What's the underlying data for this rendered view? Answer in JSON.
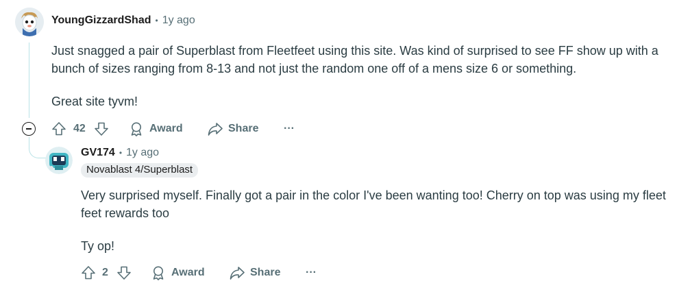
{
  "comments": [
    {
      "username": "YoungGizzardShad",
      "separator": "•",
      "time": "1y ago",
      "paragraphs": [
        "Just snagged a pair of Superblast from Fleetfeet using this site. Was kind of surprised to see FF show up with a bunch of sizes ranging from 8-13 and not just the random one off of a mens size 6 or something.",
        "Great site tyvm!"
      ],
      "votes": "42",
      "award_label": "Award",
      "share_label": "Share",
      "more_label": "···"
    },
    {
      "username": "GV174",
      "separator": "•",
      "time": "1y ago",
      "flair": "Novablast 4/Superblast",
      "paragraphs": [
        "Very surprised myself. Finally got a pair in the color I've been wanting too! Cherry on top was using my fleet feet rewards too",
        "Ty op!"
      ],
      "votes": "2",
      "award_label": "Award",
      "share_label": "Share",
      "more_label": "···"
    }
  ],
  "icons": {
    "upvote": "upvote-arrow-icon",
    "downvote": "downvote-arrow-icon",
    "award": "award-ribbon-icon",
    "share": "share-arrow-icon",
    "collapse": "collapse-minus-icon"
  }
}
